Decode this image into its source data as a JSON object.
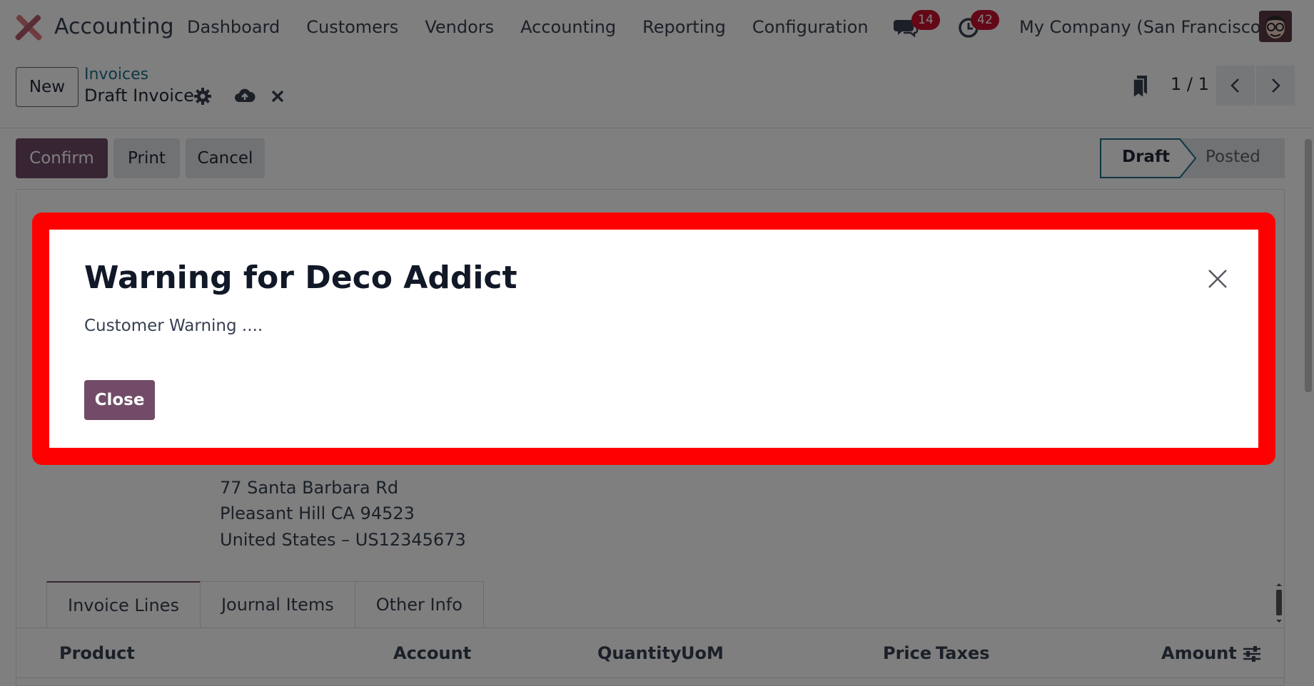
{
  "navbar": {
    "app_name": "Accounting",
    "menu": [
      "Dashboard",
      "Customers",
      "Vendors",
      "Accounting",
      "Reporting",
      "Configuration"
    ],
    "messages_badge": "14",
    "activities_badge": "42",
    "company": "My Company (San Francisco)"
  },
  "control_panel": {
    "new_label": "New",
    "breadcrumb_parent": "Invoices",
    "breadcrumb_current": "Draft Invoice",
    "pager_value": "1 / 1"
  },
  "statusbar": {
    "confirm_label": "Confirm",
    "print_label": "Print",
    "cancel_label": "Cancel",
    "stages": [
      "Draft",
      "Posted"
    ],
    "active_stage": "Draft"
  },
  "address": {
    "line1": "77 Santa Barbara Rd",
    "line2": "Pleasant Hill CA 94523",
    "line3": "United States – US12345673"
  },
  "tabs": [
    "Invoice Lines",
    "Journal Items",
    "Other Info"
  ],
  "table": {
    "columns": [
      "Product",
      "Account",
      "Quantity",
      "UoM",
      "Price",
      "Taxes",
      "Amount"
    ]
  },
  "modal": {
    "title": "Warning for Deco Addict",
    "body": "Customer Warning ....",
    "close_label": "Close"
  },
  "colors": {
    "brand": "#714b67",
    "badge": "#c8102e",
    "highlight": "#ff0000"
  }
}
